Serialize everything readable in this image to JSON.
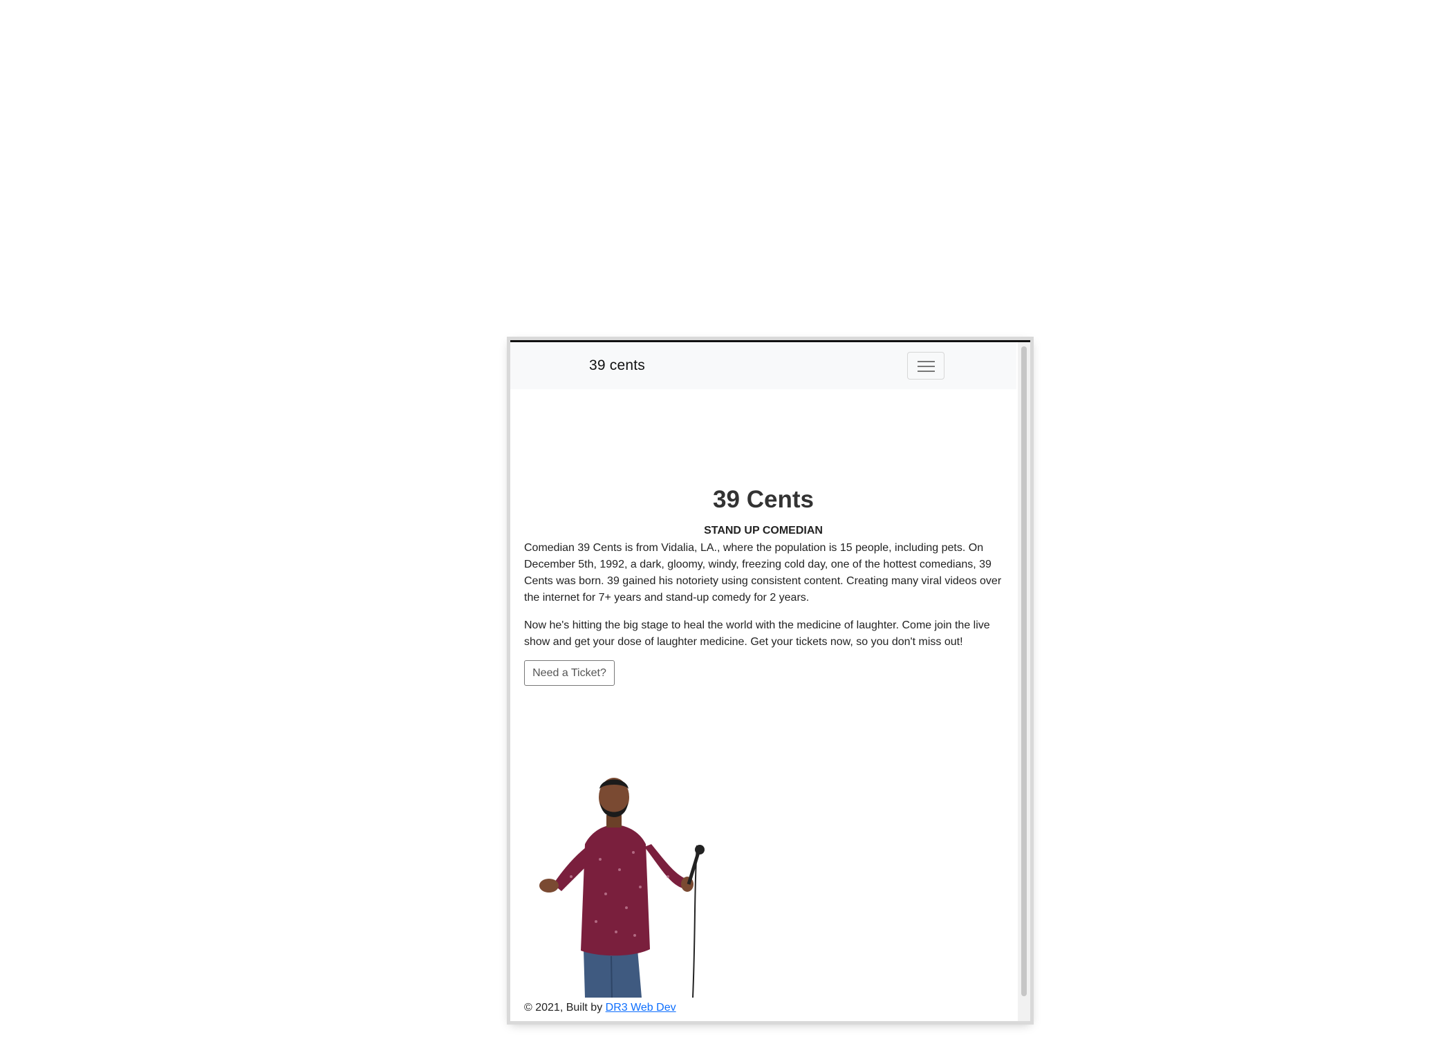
{
  "navbar": {
    "brand": "39 cents",
    "toggler_icon": "hamburger-menu-icon"
  },
  "hero": {
    "title": "39 Cents",
    "subtitle": "STAND UP COMEDIAN",
    "paragraph1": "Comedian 39 Cents is from Vidalia, LA., where the population is 15 people, including pets. On December 5th, 1992, a dark, gloomy, windy, freezing cold day, one of the hottest comedians, 39 Cents was born. 39 gained his notoriety using consistent content. Creating many viral videos over the internet for 7+ years and stand-up comedy for 2 years.",
    "paragraph2": "Now he's hitting the big stage to heal the world with the medicine of laughter. Come join the live show and get your dose of laughter medicine. Get your tickets now, so you don't miss out!",
    "ticket_button": "Need a Ticket?"
  },
  "footer": {
    "copyright": "© 2021, Built by",
    "link_text": "DR3 Web Dev"
  },
  "colors": {
    "navbar_bg": "#f8f9fa",
    "shirt": "#7a1f3d",
    "jeans": "#3f5a80",
    "link": "#0d6efd"
  }
}
